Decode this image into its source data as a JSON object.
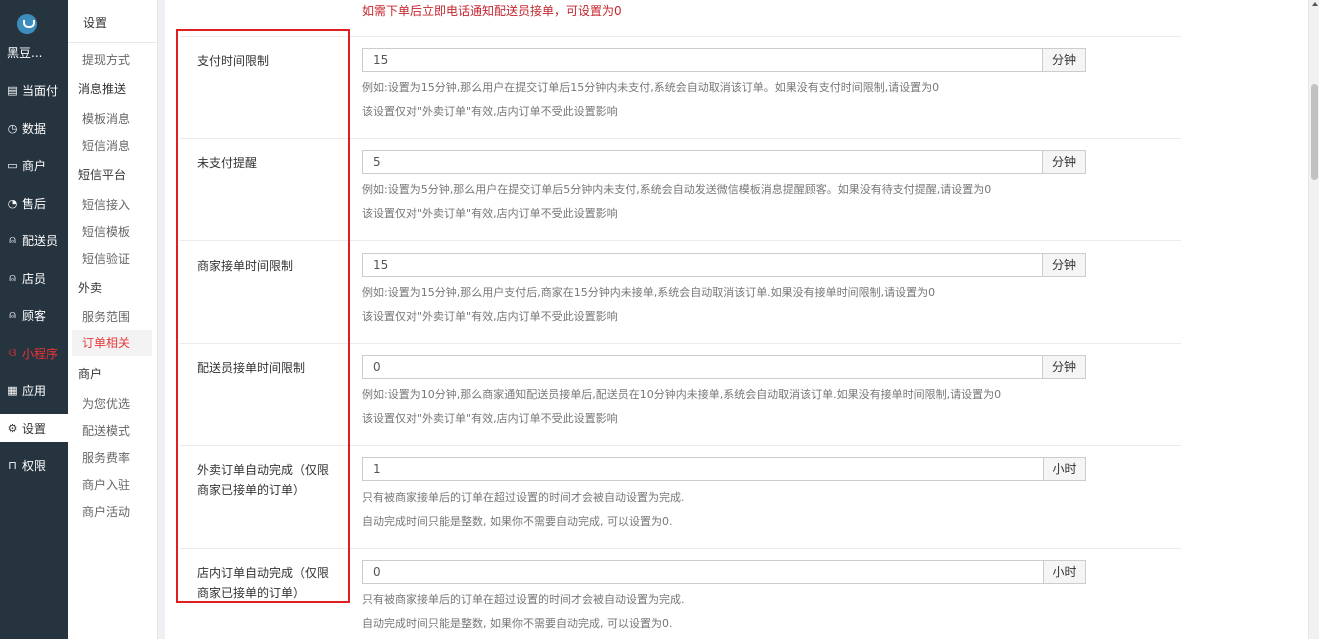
{
  "rail": {
    "shop_name": "黑豆...",
    "items": [
      {
        "icon": "receipt-icon",
        "glyph": "▤",
        "label": "当面付"
      },
      {
        "icon": "dashboard-icon",
        "glyph": "◷",
        "label": "数据"
      },
      {
        "icon": "store-icon",
        "glyph": "▭",
        "label": "商户"
      },
      {
        "icon": "service-icon",
        "glyph": "◔",
        "label": "售后"
      },
      {
        "icon": "courier-icon",
        "glyph": "⍝",
        "label": "配送员"
      },
      {
        "icon": "clerk-icon",
        "glyph": "⍝",
        "label": "店员"
      },
      {
        "icon": "customer-icon",
        "glyph": "⍝",
        "label": "顾客"
      },
      {
        "icon": "miniprogram-icon",
        "glyph": "ଓ",
        "label": "小程序"
      },
      {
        "icon": "apps-icon",
        "glyph": "▦",
        "label": "应用"
      },
      {
        "icon": "gear-icon",
        "glyph": "⚙",
        "label": "设置"
      },
      {
        "icon": "lock-icon",
        "glyph": "⊓",
        "label": "权限"
      }
    ]
  },
  "submenu": {
    "title": "设置",
    "entries": [
      {
        "type": "item",
        "label": "提现方式"
      },
      {
        "type": "group",
        "label": "消息推送"
      },
      {
        "type": "item",
        "label": "模板消息"
      },
      {
        "type": "item",
        "label": "短信消息"
      },
      {
        "type": "group",
        "label": "短信平台"
      },
      {
        "type": "item",
        "label": "短信接入"
      },
      {
        "type": "item",
        "label": "短信模板"
      },
      {
        "type": "item",
        "label": "短信验证"
      },
      {
        "type": "group",
        "label": "外卖"
      },
      {
        "type": "item",
        "label": "服务范围"
      },
      {
        "type": "item",
        "label": "订单相关",
        "active": true
      },
      {
        "type": "group",
        "label": "商户"
      },
      {
        "type": "item",
        "label": "为您优选"
      },
      {
        "type": "item",
        "label": "配送模式"
      },
      {
        "type": "item",
        "label": "服务费率"
      },
      {
        "type": "item",
        "label": "商户入驻"
      },
      {
        "type": "item",
        "label": "商户活动"
      }
    ]
  },
  "top_hint": "如需下单后立即电话通知配送员接单，可设置为0",
  "colors": {
    "accent": "#e4393c",
    "box": "#e02020",
    "rail": "#263440"
  },
  "settings": [
    {
      "label": "支付时间限制",
      "value": "15",
      "unit": "分钟",
      "help1": "例如:设置为15分钟,那么用户在提交订单后15分钟内未支付,系统会自动取消该订单。如果没有支付时间限制,请设置为0",
      "help2": "该设置仅对\"外卖订单\"有效,店内订单不受此设置影响"
    },
    {
      "label": "未支付提醒",
      "value": "5",
      "unit": "分钟",
      "help1": "例如:设置为5分钟,那么用户在提交订单后5分钟内未支付,系统会自动发送微信模板消息提醒顾客。如果没有待支付提醒,请设置为0",
      "help2": "该设置仅对\"外卖订单\"有效,店内订单不受此设置影响"
    },
    {
      "label": "商家接单时间限制",
      "value": "15",
      "unit": "分钟",
      "help1": "例如:设置为15分钟,那么用户支付后,商家在15分钟内未接单,系统会自动取消该订单.如果没有接单时间限制,请设置为0",
      "help2": "该设置仅对\"外卖订单\"有效,店内订单不受此设置影响"
    },
    {
      "label": "配送员接单时间限制",
      "value": "0",
      "unit": "分钟",
      "help1": "例如:设置为10分钟,那么商家通知配送员接单后,配送员在10分钟内未接单,系统会自动取消该订单.如果没有接单时间限制,请设置为0",
      "help2": "该设置仅对\"外卖订单\"有效,店内订单不受此设置影响"
    },
    {
      "label": "外卖订单自动完成（仅限商家已接单的订单）",
      "value": "1",
      "unit": "小时",
      "help1": "只有被商家接单后的订单在超过设置的时间才会被自动设置为完成.",
      "help2": "自动完成时间只能是整数, 如果你不需要自动完成, 可以设置为0."
    },
    {
      "label": "店内订单自动完成（仅限商家已接单的订单）",
      "value": "0",
      "unit": "小时",
      "help1": "只有被商家接单后的订单在超过设置的时间才会被自动设置为完成.",
      "help2": "自动完成时间只能是整数, 如果你不需要自动完成, 可以设置为0."
    }
  ]
}
